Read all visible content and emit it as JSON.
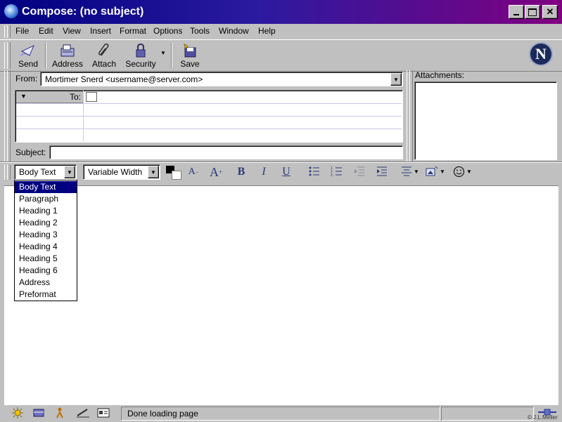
{
  "window": {
    "title": "Compose: (no subject)"
  },
  "menu": [
    "File",
    "Edit",
    "View",
    "Insert",
    "Format",
    "Options",
    "Tools",
    "Window",
    "Help"
  ],
  "toolbar": {
    "send": "Send",
    "address": "Address",
    "attach": "Attach",
    "security": "Security",
    "save": "Save"
  },
  "header": {
    "from_label": "From:",
    "from_value": "Mortimer Snerd <username@server.com>",
    "to_label": "To:",
    "subject_label": "Subject:",
    "subject_value": "",
    "attachments_label": "Attachments:"
  },
  "format": {
    "style_value": "Body Text",
    "font_value": "Variable Width",
    "bold": "B",
    "italic": "I",
    "underline": "U"
  },
  "style_options": [
    "Body Text",
    "Paragraph",
    "Heading 1",
    "Heading 2",
    "Heading 3",
    "Heading 4",
    "Heading 5",
    "Heading 6",
    "Address",
    "Preformat"
  ],
  "status": {
    "text": "Done loading page",
    "credit": "© J.L.Meller"
  },
  "colors": {
    "title_start": "#000080",
    "title_end": "#800080",
    "selection": "#000080"
  }
}
